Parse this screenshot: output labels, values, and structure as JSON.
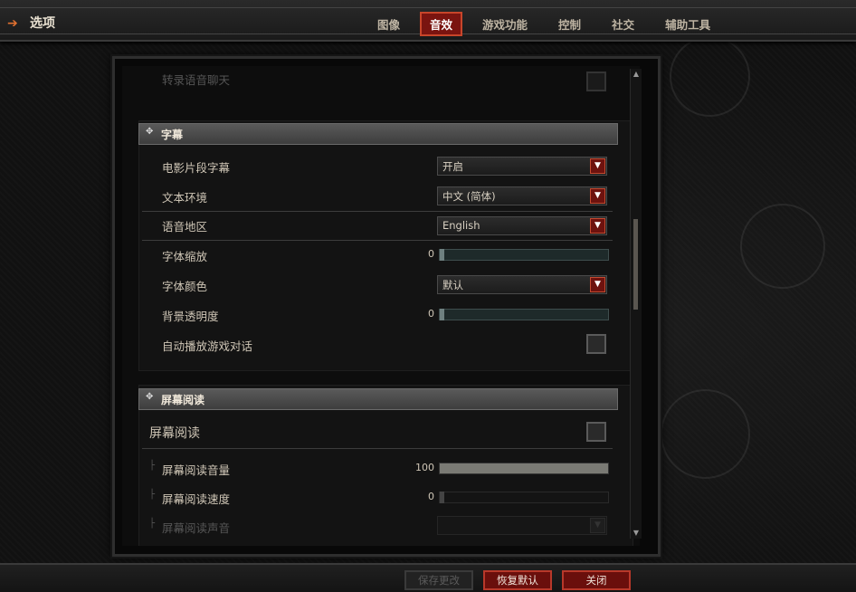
{
  "header": {
    "title": "选项",
    "tabs": [
      {
        "label": "图像",
        "active": false
      },
      {
        "label": "音效",
        "active": true
      },
      {
        "label": "游戏功能",
        "active": false
      },
      {
        "label": "控制",
        "active": false
      },
      {
        "label": "社交",
        "active": false
      },
      {
        "label": "辅助工具",
        "active": false
      }
    ]
  },
  "top_partial_row": {
    "label": "转录语音聊天"
  },
  "subtitles": {
    "header": "字幕",
    "cinematic_subtitles": {
      "label": "电影片段字幕",
      "value": "开启"
    },
    "text_locale": {
      "label": "文本环境",
      "value": "中文 (简体)"
    },
    "voice_region": {
      "label": "语音地区",
      "value": "English"
    },
    "font_scale": {
      "label": "字体缩放",
      "value": "0",
      "level": 0
    },
    "font_color": {
      "label": "字体颜色",
      "value": "默认"
    },
    "bg_opacity": {
      "label": "背景透明度",
      "value": "0",
      "level": 0
    },
    "autoplay_dialog": {
      "label": "自动播放游戏对话",
      "checked": false
    }
  },
  "screen_reader": {
    "header": "屏幕阅读",
    "toggle": {
      "label": "屏幕阅读",
      "checked": false
    },
    "volume": {
      "label": "屏幕阅读音量",
      "value": "100",
      "level": 100
    },
    "speed": {
      "label": "屏幕阅读速度",
      "value": "0",
      "level": 0
    },
    "voice": {
      "label": "屏幕阅读声音"
    }
  },
  "footer": {
    "save_label": "保存更改",
    "restore_label": "恢复默认",
    "close_label": "关闭"
  },
  "colors": {
    "accent_red": "#7a1410",
    "accent_border": "#c8452a",
    "back_arrow": "#e07030"
  }
}
